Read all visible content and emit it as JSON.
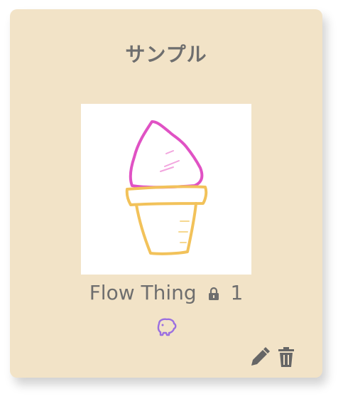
{
  "card": {
    "title": "サンプル",
    "item_name": "Flow Thing",
    "lock_count": "1",
    "icons": {
      "lock": "lock-icon",
      "badge": "pig-icon",
      "edit": "pencil-icon",
      "delete": "trash-icon"
    },
    "colors": {
      "card_bg": "#f2e3c7",
      "text": "#6e6e6e",
      "badge": "#9b6fe0",
      "cone": "#f2c25a",
      "cream": "#e052c4"
    }
  }
}
